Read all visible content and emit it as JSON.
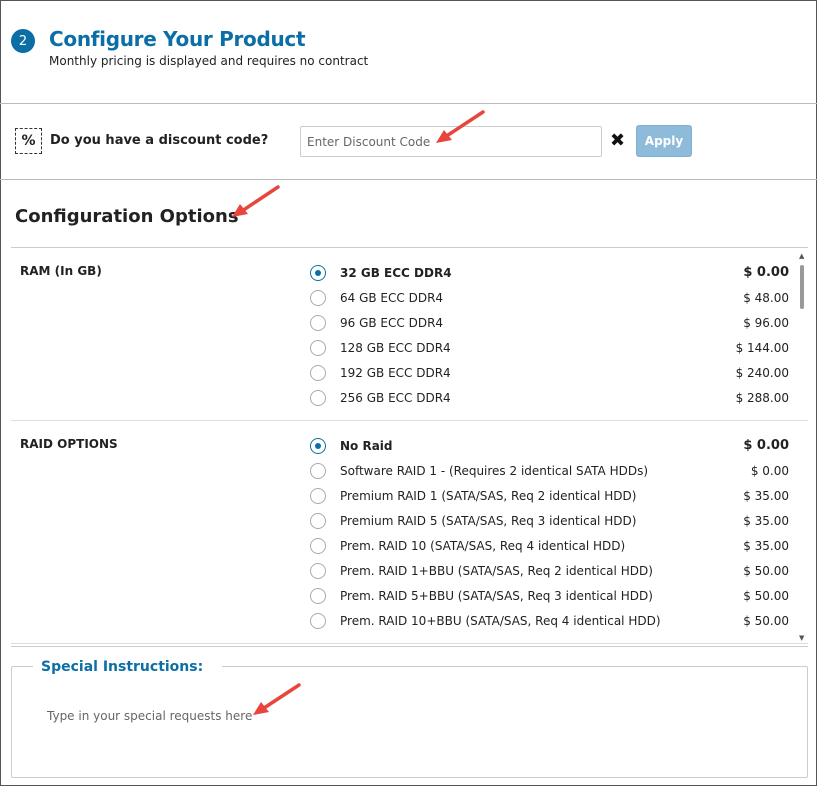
{
  "header": {
    "step_number": "2",
    "title": "Configure Your Product",
    "subtitle": "Monthly pricing is displayed and requires no contract"
  },
  "discount": {
    "icon": "percent-tag-icon",
    "label": "Do you have a discount code?",
    "placeholder": "Enter Discount Code",
    "clear_icon": "✖",
    "apply_label": "Apply"
  },
  "config": {
    "title": "Configuration Options",
    "groups": [
      {
        "label": "RAM (In GB)",
        "options": [
          {
            "label": "32 GB ECC DDR4",
            "price": "$ 0.00",
            "selected": true
          },
          {
            "label": "64 GB ECC DDR4",
            "price": "$ 48.00",
            "selected": false
          },
          {
            "label": "96 GB ECC DDR4",
            "price": "$ 96.00",
            "selected": false
          },
          {
            "label": "128 GB ECC DDR4",
            "price": "$ 144.00",
            "selected": false
          },
          {
            "label": "192 GB ECC DDR4",
            "price": "$ 240.00",
            "selected": false
          },
          {
            "label": "256 GB ECC DDR4",
            "price": "$ 288.00",
            "selected": false
          }
        ]
      },
      {
        "label": "RAID OPTIONS",
        "options": [
          {
            "label": "No Raid",
            "price": "$ 0.00",
            "selected": true
          },
          {
            "label": "Software RAID 1 - (Requires 2 identical SATA HDDs)",
            "price": "$ 0.00",
            "selected": false
          },
          {
            "label": "Premium RAID 1 (SATA/SAS, Req 2 identical HDD)",
            "price": "$ 35.00",
            "selected": false
          },
          {
            "label": "Premium RAID 5 (SATA/SAS, Req 3 identical HDD)",
            "price": "$ 35.00",
            "selected": false
          },
          {
            "label": "Prem. RAID 10 (SATA/SAS, Req 4 identical HDD)",
            "price": "$ 35.00",
            "selected": false
          },
          {
            "label": "Prem. RAID 1+BBU (SATA/SAS, Req 2 identical HDD)",
            "price": "$ 50.00",
            "selected": false
          },
          {
            "label": "Prem. RAID 5+BBU (SATA/SAS, Req 3 identical HDD)",
            "price": "$ 50.00",
            "selected": false
          },
          {
            "label": "Prem. RAID 10+BBU (SATA/SAS, Req 4 identical HDD)",
            "price": "$ 50.00",
            "selected": false
          }
        ]
      }
    ]
  },
  "special": {
    "legend": "Special Instructions:",
    "placeholder": "Type in your special requests here"
  },
  "colors": {
    "accent": "#0b6fa6",
    "apply_button": "#8dbbd9",
    "annotation_arrow": "#e8453c"
  }
}
